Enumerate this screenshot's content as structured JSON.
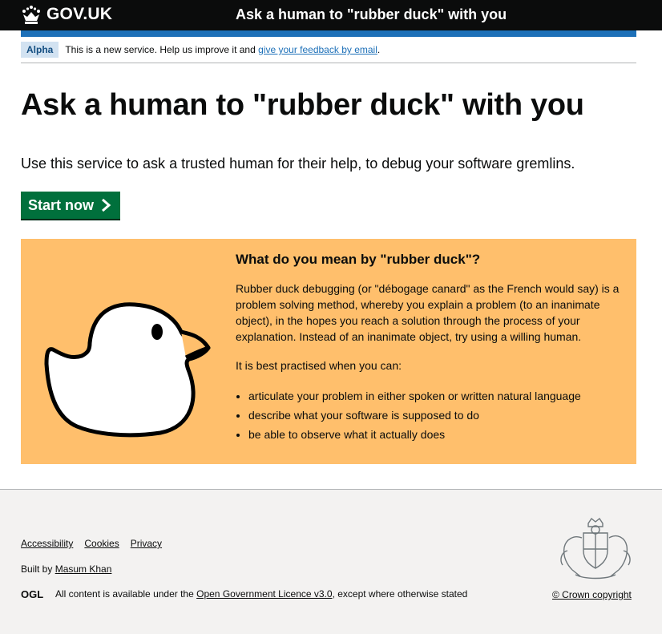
{
  "header": {
    "logo_text": "GOV.UK",
    "service_name": "Ask a human to \"rubber duck\" with you"
  },
  "phase_banner": {
    "tag": "Alpha",
    "text": "This is a new service. Help us improve it and",
    "link": "give your feedback by email",
    "suffix": "."
  },
  "main": {
    "title": "Ask a human to \"rubber duck\" with you",
    "lead": "Use this service to ask a trusted human for their help, to debug your software gremlins.",
    "start_button": "Start now"
  },
  "panel": {
    "heading": "What do you mean by \"rubber duck\"?",
    "paragraph": "Rubber duck debugging (or \"débogage canard\" as the French would say) is a problem solving method, whereby you explain a problem (to an inanimate object), in the hopes you reach a solution through the process of your explanation. Instead of an inanimate object, try using a willing human.",
    "intro": "It is best practised when you can:",
    "items": [
      "articulate your problem in either spoken or written natural language",
      "describe what your software is supposed to do",
      "be able to observe what it actually does"
    ]
  },
  "footer": {
    "links": [
      "Accessibility",
      "Cookies",
      "Privacy"
    ],
    "built_by_label": "Built by",
    "built_by_name": "Masum Khan",
    "ogl_logo": "OGL",
    "licence_prefix": "All content is available under the",
    "licence_link": "Open Government Licence v3.0",
    "licence_suffix": ", except where otherwise stated",
    "copyright": "© Crown copyright"
  },
  "colors": {
    "header_bg": "#0b0c0c",
    "brand_blue": "#1d70b8",
    "button_green": "#00703c",
    "panel_bg": "#ffbf6c",
    "footer_bg": "#f3f2f1"
  }
}
